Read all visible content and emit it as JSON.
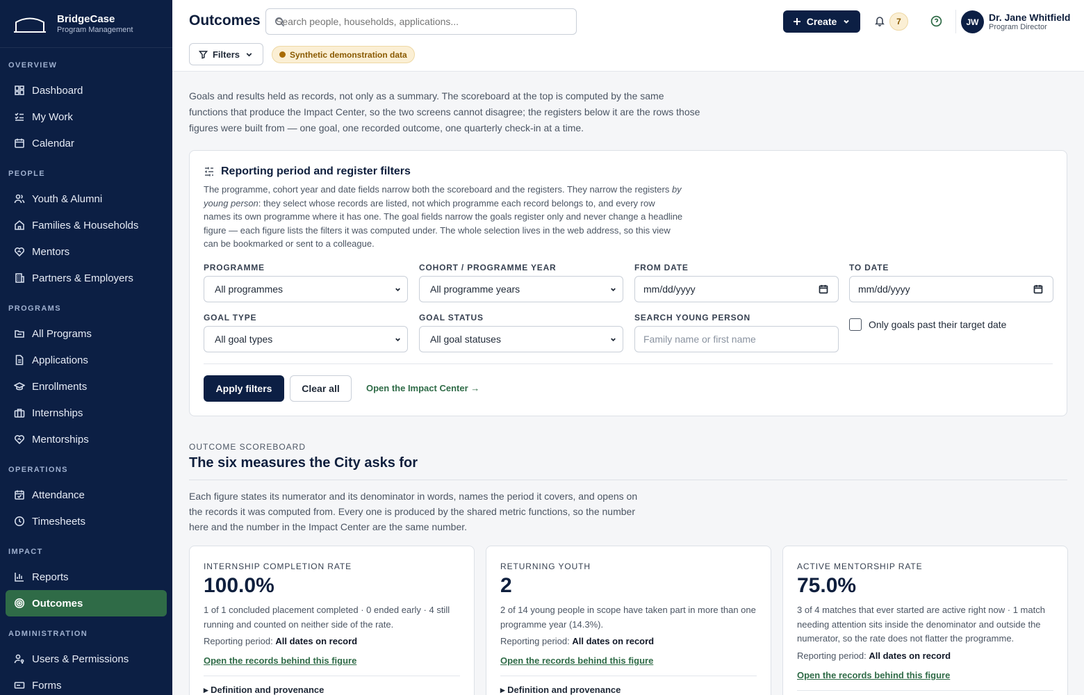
{
  "brand": {
    "name": "BridgeCase",
    "subtitle": "Program Management"
  },
  "sidebar": {
    "sections": [
      {
        "title": "OVERVIEW",
        "items": [
          {
            "label": "Dashboard",
            "icon": "dashboard-icon"
          },
          {
            "label": "My Work",
            "icon": "checklist-icon"
          },
          {
            "label": "Calendar",
            "icon": "calendar-icon"
          }
        ]
      },
      {
        "title": "PEOPLE",
        "items": [
          {
            "label": "Youth & Alumni",
            "icon": "users-icon"
          },
          {
            "label": "Families & Households",
            "icon": "home-icon"
          },
          {
            "label": "Mentors",
            "icon": "heart-handshake-icon"
          },
          {
            "label": "Partners & Employers",
            "icon": "building-icon"
          }
        ]
      },
      {
        "title": "PROGRAMS",
        "items": [
          {
            "label": "All Programs",
            "icon": "folder-icon"
          },
          {
            "label": "Applications",
            "icon": "file-icon"
          },
          {
            "label": "Enrollments",
            "icon": "graduation-cap-icon"
          },
          {
            "label": "Internships",
            "icon": "briefcase-icon"
          },
          {
            "label": "Mentorships",
            "icon": "heart-handshake-icon"
          }
        ]
      },
      {
        "title": "OPERATIONS",
        "items": [
          {
            "label": "Attendance",
            "icon": "calendar-check-icon"
          },
          {
            "label": "Timesheets",
            "icon": "clock-icon"
          }
        ]
      },
      {
        "title": "IMPACT",
        "items": [
          {
            "label": "Reports",
            "icon": "bar-chart-icon"
          },
          {
            "label": "Outcomes",
            "icon": "target-icon",
            "active": true
          }
        ]
      },
      {
        "title": "ADMINISTRATION",
        "items": [
          {
            "label": "Users & Permissions",
            "icon": "user-key-icon"
          },
          {
            "label": "Forms",
            "icon": "form-icon"
          }
        ]
      }
    ]
  },
  "header": {
    "title": "Outcomes",
    "search_placeholder": "Search people, households, applications...",
    "create_label": "Create",
    "notification_count": "7",
    "user": {
      "initials": "JW",
      "name": "Dr. Jane Whitfield",
      "role": "Program Director"
    },
    "filters_label": "Filters",
    "demo_badge": "Synthetic demonstration data"
  },
  "intro": "Goals and results held as records, not only as a summary. The scoreboard at the top is computed by the same functions that produce the Impact Center, so the two screens cannot disagree; the registers below it are the rows those figures were built from — one goal, one recorded outcome, one quarterly check-in at a time.",
  "filter_card": {
    "title": "Reporting period and register filters",
    "desc_before": "The programme, cohort year and date fields narrow both the scoreboard and the registers. They narrow the registers ",
    "desc_em": "by young person",
    "desc_after": ": they select whose records are listed, not which programme each record belongs to, and every row names its own programme where it has one. The goal fields narrow the goals register only and never change a headline figure — each figure lists the filters it was computed under. The whole selection lives in the web address, so this view can be bookmarked or sent to a colleague.",
    "programme": {
      "label": "PROGRAMME",
      "value": "All programmes"
    },
    "cohort": {
      "label": "COHORT / PROGRAMME YEAR",
      "value": "All programme years"
    },
    "from_date": {
      "label": "FROM DATE",
      "placeholder": "mm/dd/yyyy"
    },
    "to_date": {
      "label": "TO DATE",
      "placeholder": "mm/dd/yyyy"
    },
    "goal_type": {
      "label": "GOAL TYPE",
      "value": "All goal types"
    },
    "goal_status": {
      "label": "GOAL STATUS",
      "value": "All goal statuses"
    },
    "search_person": {
      "label": "SEARCH YOUNG PERSON",
      "placeholder": "Family name or first name"
    },
    "overdue_checkbox": "Only goals past their target date",
    "apply_label": "Apply filters",
    "clear_label": "Clear all",
    "impact_link": "Open the Impact Center →"
  },
  "scoreboard": {
    "eyebrow": "OUTCOME SCOREBOARD",
    "title": "The six measures the City asks for",
    "desc": "Each figure states its numerator and its denominator in words, names the period it covers, and opens on the records it was computed from. Every one is produced by the shared metric functions, so the number here and the number in the Impact Center are the same number.",
    "period_label": "Reporting period:",
    "link_label": "Open the records behind this figure",
    "definition_label": "Definition and provenance",
    "cards": [
      {
        "label": "INTERNSHIP COMPLETION RATE",
        "value": "100.0%",
        "desc": "1 of 1 concluded placement completed · 0 ended early · 4 still running and counted on neither side of the rate.",
        "period": "All dates on record"
      },
      {
        "label": "RETURNING YOUTH",
        "value": "2",
        "desc": "2 of 14 young people in scope have taken part in more than one programme year (14.3%).",
        "period": "All dates on record"
      },
      {
        "label": "ACTIVE MENTORSHIP RATE",
        "value": "75.0%",
        "desc": "3 of 4 matches that ever started are active right now · 1 match needing attention sits inside the denominator and outside the numerator, so the rate does not flatter the programme.",
        "period": "All dates on record"
      }
    ]
  }
}
